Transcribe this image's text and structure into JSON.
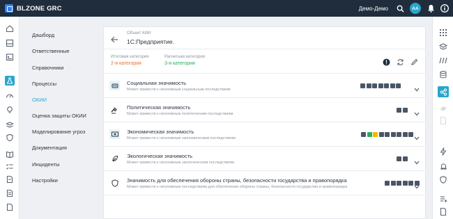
{
  "topbar": {
    "logo_text": "BLZONE GRC",
    "user_name": "Демо-Демо",
    "avatar_initials": "AA"
  },
  "nav": {
    "items": [
      {
        "label": "Дашборд"
      },
      {
        "label": "Ответственные"
      },
      {
        "label": "Справочники"
      },
      {
        "label": "Процессы"
      },
      {
        "label": "ОКИИ"
      },
      {
        "label": "Оценка защиты ОКИИ"
      },
      {
        "label": "Моделирование угроз"
      },
      {
        "label": "Документация"
      },
      {
        "label": "Инциденты"
      },
      {
        "label": "Настройки"
      }
    ],
    "active_index": 4
  },
  "object": {
    "label": "Объект КИИ",
    "title": "1С:Предприятие."
  },
  "categories": {
    "final_label": "Итоговая категория",
    "final_value": "2-я категория",
    "final_color": "#e8702a",
    "calc_label": "Расчетная категория",
    "calc_value": "3-я категория",
    "calc_color": "#2eaa5c"
  },
  "significances": [
    {
      "title": "Социальная значимость",
      "desc": "Может привести к негативным социальным последствиям",
      "bars": [
        "#4a5664",
        "#4a5664",
        "#4a5664",
        "#4a5664",
        "#4a5664",
        "#4a5664",
        "#4a5664"
      ]
    },
    {
      "title": "Политическая значимость",
      "desc": "Может привести к негативным политическим последствиям",
      "bars": [
        "#4a5664",
        "#4a5664"
      ]
    },
    {
      "title": "Экономическая значимость",
      "desc": "Может привести к негативным экономическим последствиям",
      "bars": [
        "#4a5664",
        "#2eaa5c",
        "#f5b800",
        "#4a5664",
        "#4a5664",
        "#4a5664",
        "#4a5664",
        "#4a5664",
        "#4a5664"
      ]
    },
    {
      "title": "Экологическая значимость",
      "desc": "Может привести к негативным экологическим последствиям",
      "bars": [
        "#4a5664",
        "#4a5664"
      ]
    },
    {
      "title": "Значимость для обеспечения обороны страны, безопасности государства и правопорядка",
      "desc": "Может привести к негативным последствиям для обеспечения обороны страны, безопасности государства и правопорядка",
      "bars": [
        "#4a5664",
        "#4a5664",
        "#4a5664",
        "#4a5664",
        "#4a5664",
        "#4a5664"
      ]
    }
  ],
  "colors": {
    "accent": "#2aa6c9",
    "topbar": "#1f2d3d"
  },
  "icons": {
    "left_rail": [
      "home-icon",
      "inbox-icon",
      "calendar-icon",
      "flask-icon",
      "gauge-icon",
      "bulb-icon",
      "layers-icon",
      "shield-icon",
      "book-icon",
      "checklist-icon",
      "doc-icon"
    ],
    "right_rail": [
      "grid-icon",
      "layers-icon",
      "slashes-icon",
      "database-icon",
      "share-icon",
      "fingerprint-icon",
      "doc-icon",
      "bolt-icon",
      "alarm-icon",
      "shield-icon",
      "list-add-icon"
    ]
  }
}
